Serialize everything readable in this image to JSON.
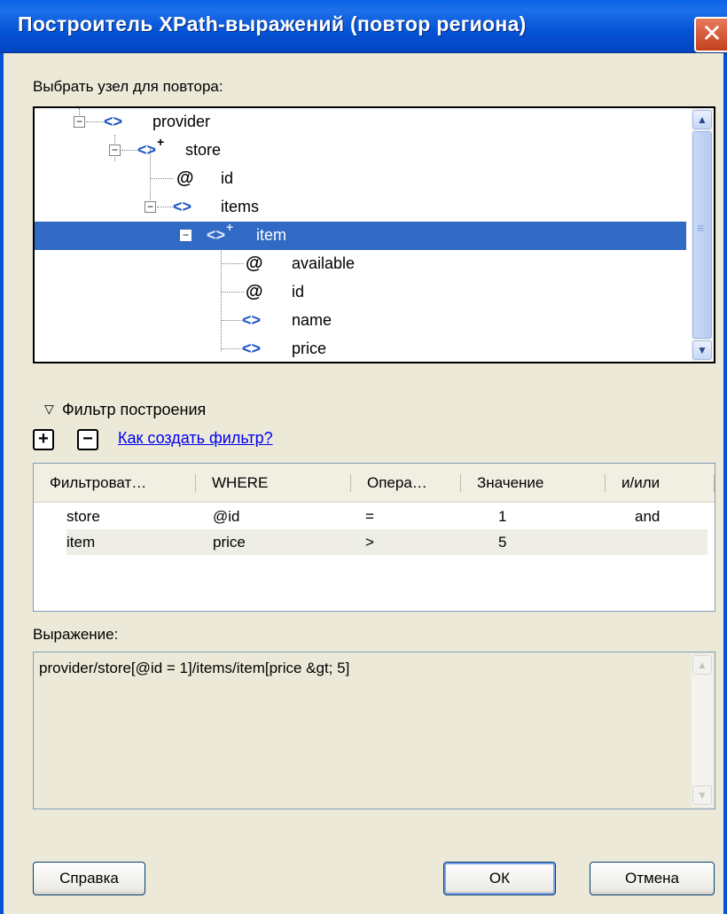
{
  "window": {
    "title": "Построитель XPath-выражений (повтор региона)",
    "close_glyph": "✕"
  },
  "tree": {
    "label": "Выбрать узел для повтора:",
    "nodes": [
      {
        "name": "provider",
        "kind": "element"
      },
      {
        "name": "store",
        "kind": "element-repeat"
      },
      {
        "name": "id",
        "kind": "attribute"
      },
      {
        "name": "items",
        "kind": "element"
      },
      {
        "name": "item",
        "kind": "element-repeat",
        "selected": true
      },
      {
        "name": "available",
        "kind": "attribute"
      },
      {
        "name": "id",
        "kind": "attribute"
      },
      {
        "name": "name",
        "kind": "element"
      },
      {
        "name": "price",
        "kind": "element"
      }
    ],
    "expander_minus": "−",
    "element_glyph": "<>",
    "repeat_glyph": "+",
    "attribute_glyph": "@",
    "scroll_up": "▲",
    "scroll_down": "▼",
    "scroll_grip": "≡"
  },
  "filter": {
    "header": "Фильтр построения",
    "header_glyph": "▽",
    "add_glyph": "+",
    "remove_glyph": "−",
    "help_link": "Как создать фильтр?",
    "columns": [
      "Фильтроват…",
      "WHERE",
      "Опера…",
      "Значение",
      "и/или"
    ],
    "rows": [
      [
        "store",
        "@id",
        "=",
        "1",
        "and"
      ],
      [
        "item",
        "price",
        ">",
        "5",
        ""
      ]
    ]
  },
  "expression": {
    "label": "Выражение:",
    "value": "provider/store[@id = 1]/items/item[price &gt; 5]"
  },
  "buttons": {
    "help": "Справка",
    "ok": "ОК",
    "cancel": "Отмена"
  }
}
